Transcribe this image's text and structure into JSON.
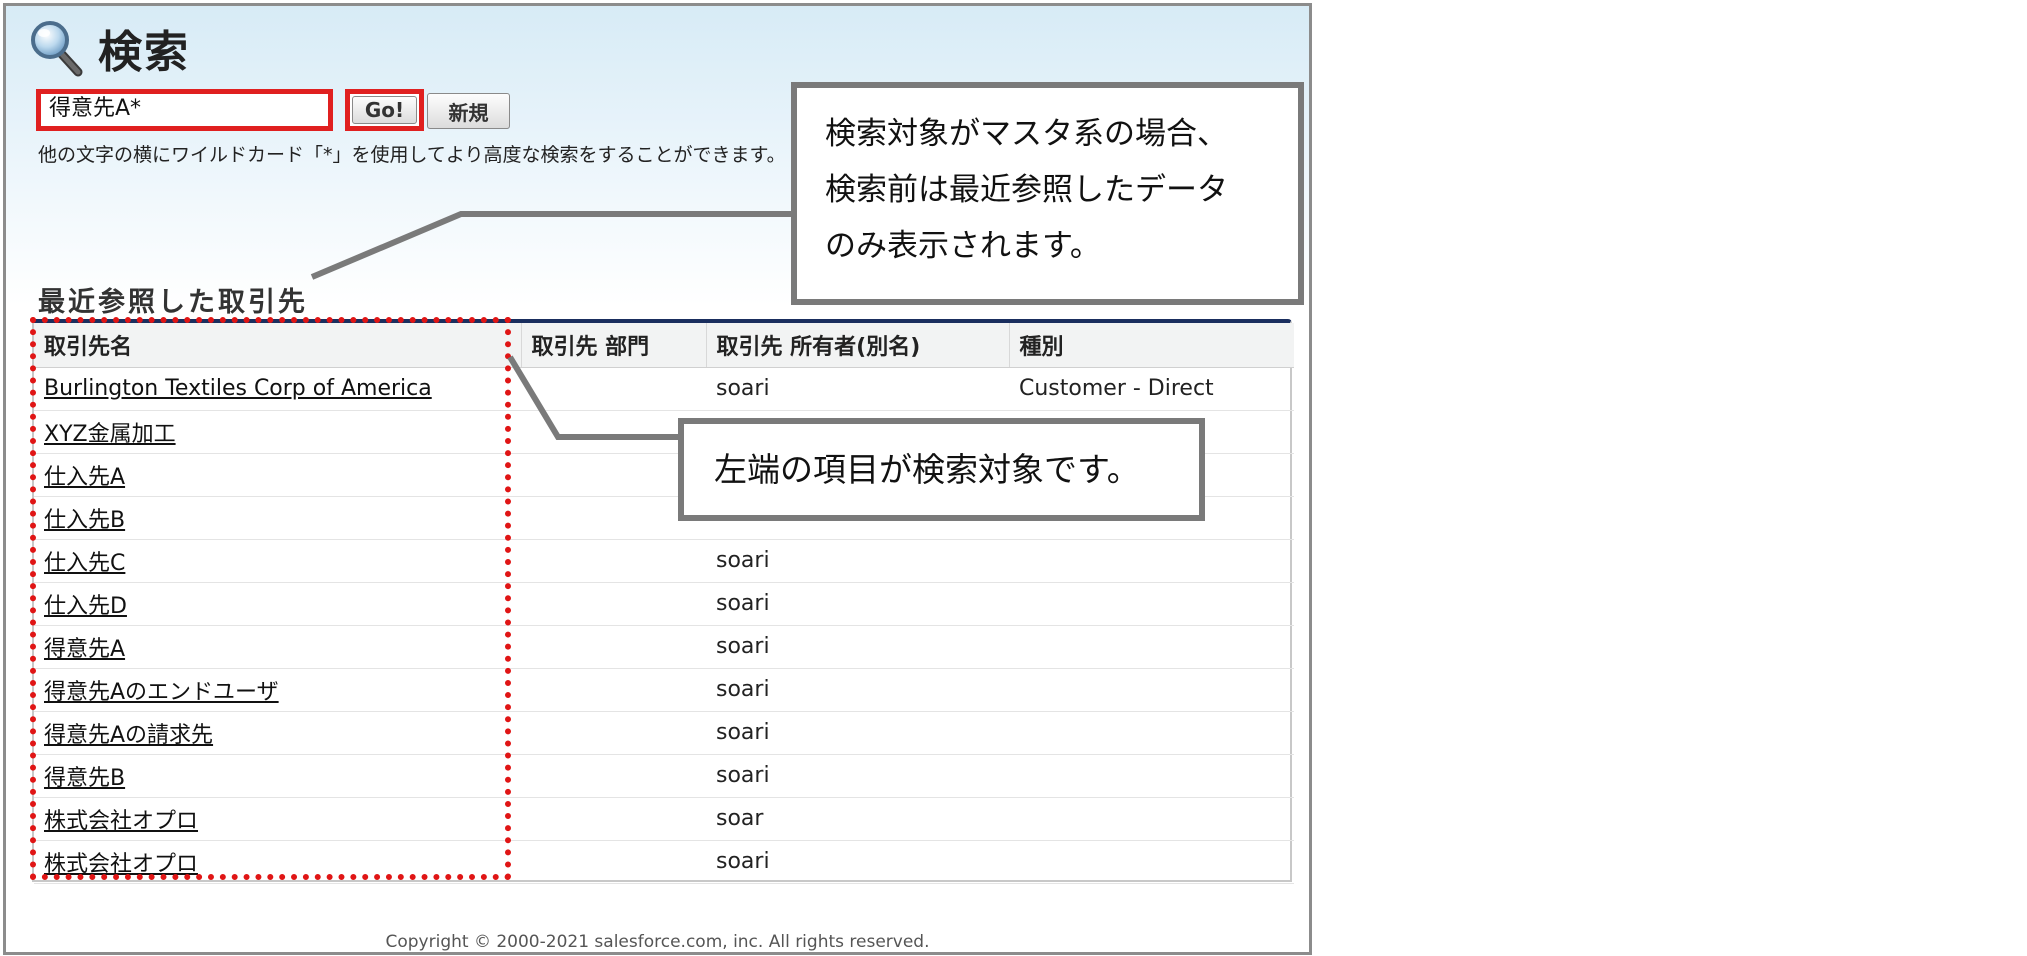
{
  "page": {
    "title": "検索",
    "icon": "search-icon"
  },
  "search": {
    "value": "得意先A*",
    "go_label": "Go!",
    "new_label": "新規",
    "hint": "他の文字の横にワイルドカード「*」を使用してより高度な検索をすることができます。"
  },
  "recent": {
    "heading": "最近参照した取引先",
    "columns": [
      "取引先名",
      "取引先 部門",
      "取引先 所有者(別名)",
      "種別"
    ],
    "rows": [
      {
        "name": "Burlington Textiles Corp of America",
        "division": "",
        "owner": "soari",
        "type": "Customer - Direct"
      },
      {
        "name": "XYZ金属加工",
        "division": "",
        "owner": "",
        "type": ""
      },
      {
        "name": "仕入先A",
        "division": "",
        "owner": "",
        "type": ""
      },
      {
        "name": "仕入先B",
        "division": "",
        "owner": "",
        "type": ""
      },
      {
        "name": "仕入先C",
        "division": "",
        "owner": "soari",
        "type": ""
      },
      {
        "name": "仕入先D",
        "division": "",
        "owner": "soari",
        "type": ""
      },
      {
        "name": "得意先A",
        "division": "",
        "owner": "soari",
        "type": ""
      },
      {
        "name": "得意先Aのエンドユーザ",
        "division": "",
        "owner": "soari",
        "type": ""
      },
      {
        "name": "得意先Aの請求先",
        "division": "",
        "owner": "soari",
        "type": ""
      },
      {
        "name": "得意先B",
        "division": "",
        "owner": "soari",
        "type": ""
      },
      {
        "name": "株式会社オプロ",
        "division": "",
        "owner": "soar",
        "type": ""
      },
      {
        "name": "株式会社オプロ",
        "division": "",
        "owner": "soari",
        "type": ""
      }
    ]
  },
  "footer": {
    "copyright": "Copyright © 2000-2021 salesforce.com, inc. All rights reserved."
  },
  "annotations": {
    "callout_1": [
      "検索対象がマスタ系の場合、",
      "検索前は最近参照したデータ",
      "のみ表示されます。"
    ],
    "callout_2": "左端の項目が検索対象です。",
    "highlight_color": "#e01515",
    "callout_border_color": "#7a7a7a"
  }
}
